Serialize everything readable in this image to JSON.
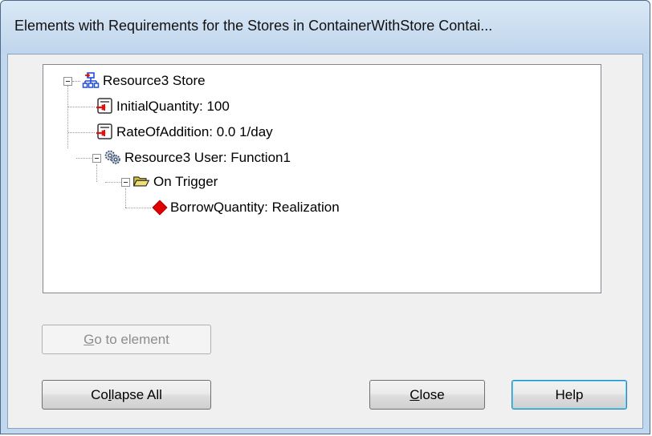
{
  "window": {
    "title": "Elements with Requirements for the Stores in ContainerWithStore Contai..."
  },
  "tree": {
    "nodes": [
      {
        "label": "Resource3 Store",
        "icon": "store-icon"
      },
      {
        "label": "InitialQuantity: 100",
        "icon": "property-input-icon"
      },
      {
        "label": "RateOfAddition: 0.0 1/day",
        "icon": "property-input-icon"
      },
      {
        "label": "Resource3 User: Function1",
        "icon": "function-gears-icon"
      },
      {
        "label": "On Trigger",
        "icon": "open-folder-icon"
      },
      {
        "label": "BorrowQuantity: Realization",
        "icon": "red-diamond-icon"
      }
    ]
  },
  "buttons": {
    "go_to_element_mnemonic": "G",
    "go_to_element_rest": "o to element",
    "collapse_all_pre": "Co",
    "collapse_all_mnemonic": "l",
    "collapse_all_rest": "lapse All",
    "close_mnemonic": "C",
    "close_rest": "lose",
    "help": "Help"
  },
  "colors": {
    "title_bar": "#c9dcf0",
    "diamond": "#e00000",
    "arrow": "#e01010",
    "folder": "#e8d25a"
  }
}
